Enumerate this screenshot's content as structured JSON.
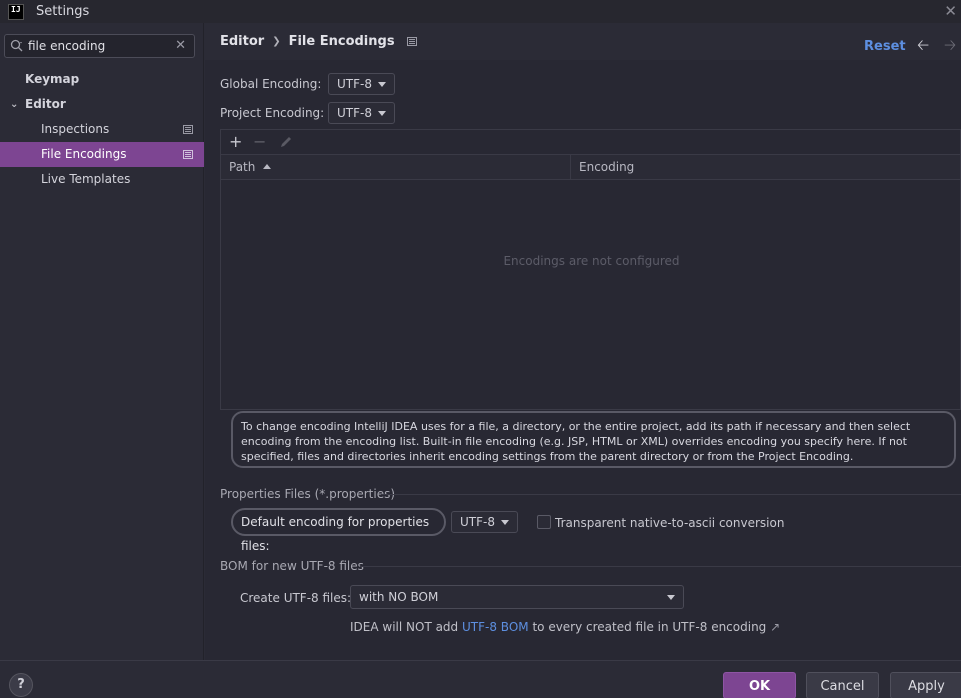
{
  "window": {
    "title": "Settings",
    "logo_text": "IJ"
  },
  "search": {
    "value": "file encoding"
  },
  "sidebar": {
    "items": [
      {
        "label": "Keymap"
      },
      {
        "label": "Editor"
      },
      {
        "label": "Inspections"
      },
      {
        "label": "File Encodings"
      },
      {
        "label": "Live Templates"
      }
    ]
  },
  "header": {
    "crumb_parent": "Editor",
    "crumb_current": "File Encodings",
    "reset_label": "Reset"
  },
  "global_encoding": {
    "label": "Global Encoding:",
    "value": "UTF-8"
  },
  "project_encoding": {
    "label": "Project Encoding:",
    "value": "UTF-8"
  },
  "table": {
    "columns": [
      "Path",
      "Encoding"
    ],
    "empty_text": "Encodings are not configured"
  },
  "info_text": "To change encoding IntelliJ IDEA uses for a file, a directory, or the entire project, add its path if necessary and then select encoding from the encoding list. Built-in file encoding (e.g. JSP, HTML or XML) overrides encoding you specify here. If not specified, files and directories inherit encoding settings from the parent directory or from the Project Encoding.",
  "properties": {
    "section_title": "Properties Files (*.properties)",
    "default_label": "Default encoding for properties files:",
    "default_value": "UTF-8",
    "checkbox_label": "Transparent native-to-ascii conversion",
    "checkbox_checked": false
  },
  "bom": {
    "section_title": "BOM for new UTF-8 files",
    "create_label": "Create UTF-8 files:",
    "create_value": "with NO BOM",
    "note_prefix": "IDEA will NOT add",
    "note_link": "UTF-8 BOM",
    "note_suffix": "to every created file in UTF-8 encoding",
    "note_arrow": "↗"
  },
  "buttons": {
    "ok": "OK",
    "cancel": "Cancel",
    "apply": "Apply",
    "help": "?"
  },
  "colors": {
    "accent": "#7d4592",
    "link": "#5d8fe0",
    "background": "#2b2b36"
  }
}
